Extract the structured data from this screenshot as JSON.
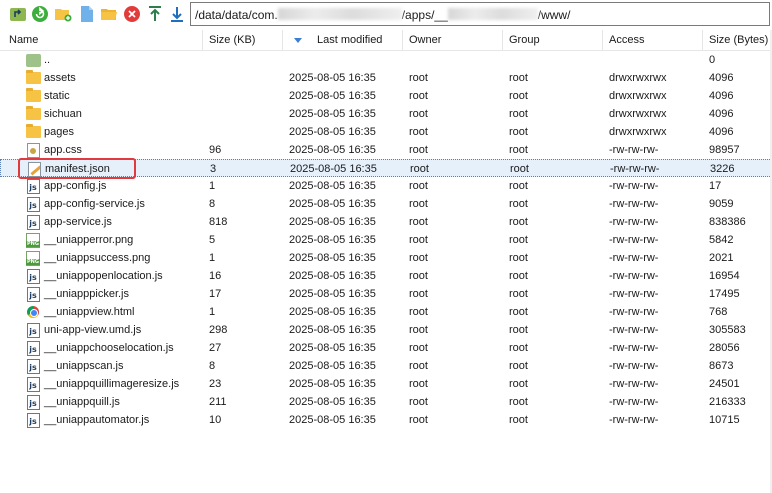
{
  "toolbar": {
    "buttons": [
      {
        "name": "parent-dir-icon"
      },
      {
        "name": "refresh-icon"
      },
      {
        "name": "new-folder-icon"
      },
      {
        "name": "new-file-icon"
      },
      {
        "name": "open-folder-icon"
      },
      {
        "name": "delete-icon"
      },
      {
        "name": "upload-icon"
      },
      {
        "name": "download-icon"
      }
    ],
    "path": {
      "prefix": "/data/data/com.",
      "middle": "/apps/__",
      "suffix": "/www/"
    }
  },
  "columns": {
    "name": "Name",
    "size": "Size (KB)",
    "modified": "Last modified",
    "owner": "Owner",
    "group": "Group",
    "access": "Access",
    "bytes": "Size (Bytes)"
  },
  "rows": [
    {
      "type": "updir",
      "name": "..",
      "size": "",
      "modified": "",
      "owner": "",
      "group": "",
      "access": "",
      "bytes": "0"
    },
    {
      "type": "folder",
      "name": "assets",
      "size": "",
      "modified": "2025-08-05 16:35",
      "owner": "root",
      "group": "root",
      "access": "drwxrwxrwx",
      "bytes": "4096"
    },
    {
      "type": "folder",
      "name": "static",
      "size": "",
      "modified": "2025-08-05 16:35",
      "owner": "root",
      "group": "root",
      "access": "drwxrwxrwx",
      "bytes": "4096"
    },
    {
      "type": "folder",
      "name": "sichuan",
      "size": "",
      "modified": "2025-08-05 16:35",
      "owner": "root",
      "group": "root",
      "access": "drwxrwxrwx",
      "bytes": "4096"
    },
    {
      "type": "folder",
      "name": "pages",
      "size": "",
      "modified": "2025-08-05 16:35",
      "owner": "root",
      "group": "root",
      "access": "drwxrwxrwx",
      "bytes": "4096"
    },
    {
      "type": "css",
      "name": "app.css",
      "size": "96",
      "modified": "2025-08-05 16:35",
      "owner": "root",
      "group": "root",
      "access": "-rw-rw-rw-",
      "bytes": "98957"
    },
    {
      "type": "json",
      "name": "manifest.json",
      "size": "3",
      "modified": "2025-08-05 16:35",
      "owner": "root",
      "group": "root",
      "access": "-rw-rw-rw-",
      "bytes": "3226",
      "selected": true
    },
    {
      "type": "js",
      "name": "app-config.js",
      "size": "1",
      "modified": "2025-08-05 16:35",
      "owner": "root",
      "group": "root",
      "access": "-rw-rw-rw-",
      "bytes": "17"
    },
    {
      "type": "js",
      "name": "app-config-service.js",
      "size": "8",
      "modified": "2025-08-05 16:35",
      "owner": "root",
      "group": "root",
      "access": "-rw-rw-rw-",
      "bytes": "9059"
    },
    {
      "type": "js",
      "name": "app-service.js",
      "size": "818",
      "modified": "2025-08-05 16:35",
      "owner": "root",
      "group": "root",
      "access": "-rw-rw-rw-",
      "bytes": "838386"
    },
    {
      "type": "png",
      "name": "__uniapperror.png",
      "size": "5",
      "modified": "2025-08-05 16:35",
      "owner": "root",
      "group": "root",
      "access": "-rw-rw-rw-",
      "bytes": "5842"
    },
    {
      "type": "png",
      "name": "__uniappsuccess.png",
      "size": "1",
      "modified": "2025-08-05 16:35",
      "owner": "root",
      "group": "root",
      "access": "-rw-rw-rw-",
      "bytes": "2021"
    },
    {
      "type": "js",
      "name": "__uniappopenlocation.js",
      "size": "16",
      "modified": "2025-08-05 16:35",
      "owner": "root",
      "group": "root",
      "access": "-rw-rw-rw-",
      "bytes": "16954"
    },
    {
      "type": "js",
      "name": "__uniapppicker.js",
      "size": "17",
      "modified": "2025-08-05 16:35",
      "owner": "root",
      "group": "root",
      "access": "-rw-rw-rw-",
      "bytes": "17495"
    },
    {
      "type": "html",
      "name": "__uniappview.html",
      "size": "1",
      "modified": "2025-08-05 16:35",
      "owner": "root",
      "group": "root",
      "access": "-rw-rw-rw-",
      "bytes": "768"
    },
    {
      "type": "js",
      "name": "uni-app-view.umd.js",
      "size": "298",
      "modified": "2025-08-05 16:35",
      "owner": "root",
      "group": "root",
      "access": "-rw-rw-rw-",
      "bytes": "305583"
    },
    {
      "type": "js",
      "name": "__uniappchooselocation.js",
      "size": "27",
      "modified": "2025-08-05 16:35",
      "owner": "root",
      "group": "root",
      "access": "-rw-rw-rw-",
      "bytes": "28056"
    },
    {
      "type": "js",
      "name": "__uniappscan.js",
      "size": "8",
      "modified": "2025-08-05 16:35",
      "owner": "root",
      "group": "root",
      "access": "-rw-rw-rw-",
      "bytes": "8673"
    },
    {
      "type": "js",
      "name": "__uniappquillimageresize.js",
      "size": "23",
      "modified": "2025-08-05 16:35",
      "owner": "root",
      "group": "root",
      "access": "-rw-rw-rw-",
      "bytes": "24501"
    },
    {
      "type": "js",
      "name": "__uniappquill.js",
      "size": "211",
      "modified": "2025-08-05 16:35",
      "owner": "root",
      "group": "root",
      "access": "-rw-rw-rw-",
      "bytes": "216333"
    },
    {
      "type": "js",
      "name": "__uniappautomator.js",
      "size": "10",
      "modified": "2025-08-05 16:35",
      "owner": "root",
      "group": "root",
      "access": "-rw-rw-rw-",
      "bytes": "10715"
    }
  ],
  "js_icon_label": "js",
  "colors": {
    "selection": "#e6f0fb",
    "highlight": "#e0393e",
    "folder": "#f6c344"
  }
}
